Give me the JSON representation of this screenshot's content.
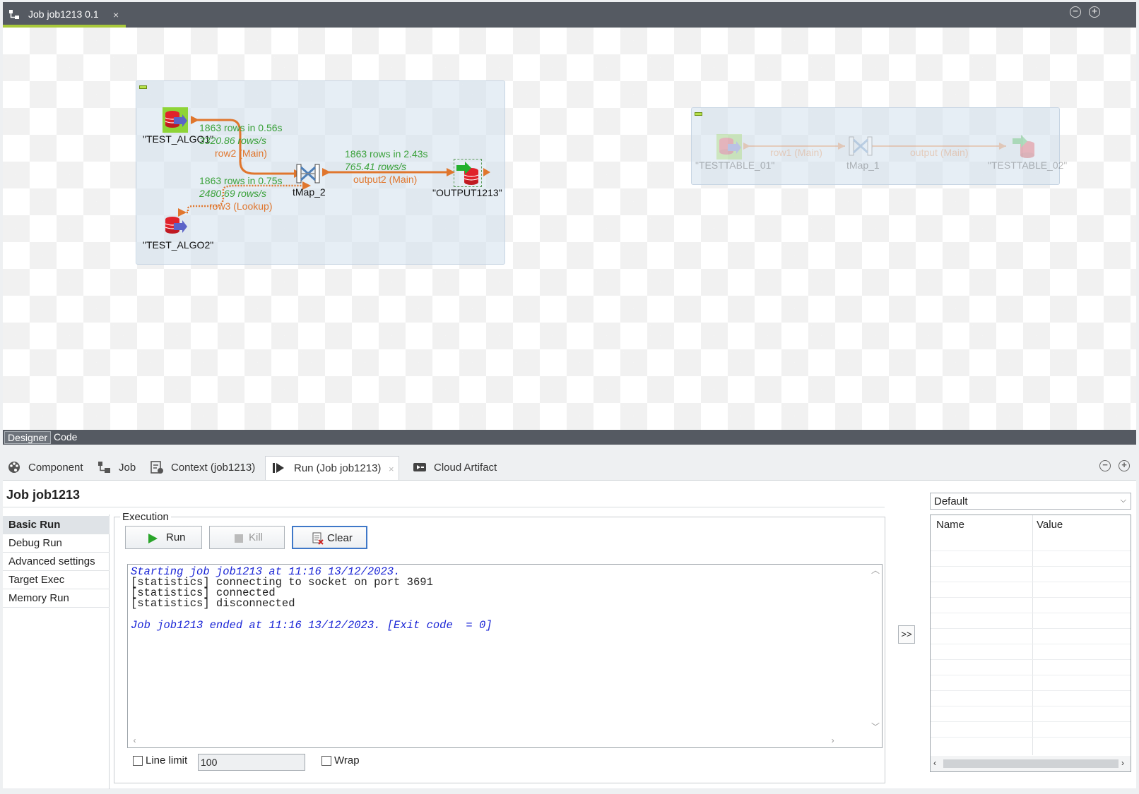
{
  "editor": {
    "tab_title": "Job job1213 0.1",
    "tab_close": "×",
    "minimize": "−",
    "maximize": "+",
    "mode_tabs": [
      "Designer",
      "Code"
    ]
  },
  "canvas": {
    "subjob1": {
      "components": {
        "source1": "\"TEST_ALGO1\"",
        "source2": "\"TEST_ALGO2\"",
        "map": "tMap_2",
        "output": "\"OUTPUT1213\""
      },
      "flows": {
        "row2": {
          "stat": "1863 rows in 0.56s",
          "rate": "3320.86 rows/s",
          "name": "row2 (Main)"
        },
        "row3": {
          "stat": "1863 rows in 0.75s",
          "rate": "2480.69 rows/s",
          "name": "row3 (Lookup)"
        },
        "output2": {
          "stat": "1863 rows in 2.43s",
          "rate": "765.41 rows/s",
          "name": "output2 (Main)"
        }
      }
    },
    "subjob2": {
      "components": {
        "source": "\"TESTTABLE_01\"",
        "map": "tMap_1",
        "output": "\"TESTTABLE_02\""
      },
      "flows": {
        "row1": "row1 (Main)",
        "output": "output (Main)"
      }
    },
    "colors": {
      "flow": "#e0762d",
      "stat": "#3aa13a",
      "db_red": "#e0222b"
    }
  },
  "views": {
    "tabs": [
      {
        "label": "Component",
        "icon": "palette-icon"
      },
      {
        "label": "Job",
        "icon": "job-icon"
      },
      {
        "label": "Context (job1213)",
        "icon": "context-icon"
      },
      {
        "label": "Run (Job job1213)",
        "icon": "run-icon"
      },
      {
        "label": "Cloud Artifact",
        "icon": "cloud-artifact-icon"
      }
    ],
    "run_tab_close": "×"
  },
  "run": {
    "job_title": "Job job1213",
    "nav": [
      "Basic Run",
      "Debug Run",
      "Advanced settings",
      "Target Exec",
      "Memory Run"
    ],
    "execution_label": "Execution",
    "buttons": {
      "run": "Run",
      "kill": "Kill",
      "clear": "Clear"
    },
    "console": [
      "Starting job job1213 at 11:16 13/12/2023.",
      "[statistics] connecting to socket on port 3691",
      "[statistics] connected",
      "[statistics] disconnected",
      "Job job1213 ended at 11:16 13/12/2023. [Exit code  = 0]"
    ],
    "line_limit_label": "Line limit",
    "line_limit_value": "100",
    "wrap_label": "Wrap",
    "arrow_button": ">>",
    "context_select": "Default",
    "context_columns": [
      "Name",
      "Value"
    ]
  }
}
